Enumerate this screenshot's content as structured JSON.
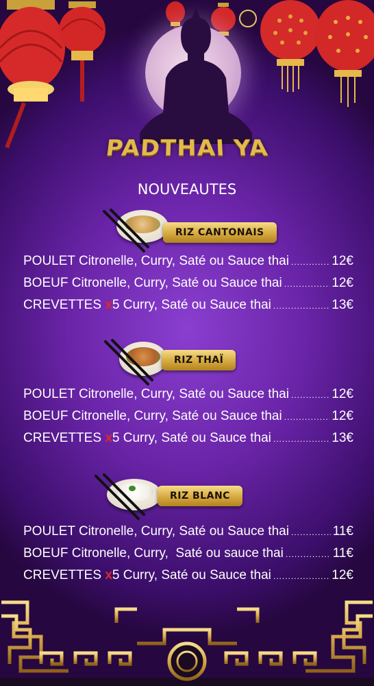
{
  "brand": "PADTHAI YA",
  "subtitle": "NOUVEAUTES",
  "sections": [
    {
      "title": "RIZ CANTONAIS",
      "items": [
        {
          "dish": "POULET Citronelle, Curry, Saté ou Sauce thai",
          "price": "12€"
        },
        {
          "dish": "BOEUF Citronelle, Curry, Saté ou Sauce thai",
          "price": "12€"
        },
        {
          "dish_prefix": "CREVETTES ",
          "multiplier_x": "x",
          "dish_suffix": "5 Curry, Saté ou Sauce thai",
          "price": "13€"
        }
      ]
    },
    {
      "title": "RIZ THAÏ",
      "items": [
        {
          "dish": "POULET Citronelle, Curry, Saté ou Sauce thai",
          "price": "12€"
        },
        {
          "dish": "BOEUF Citronelle, Curry, Saté ou Sauce thai",
          "price": "12€"
        },
        {
          "dish_prefix": "CREVETTES ",
          "multiplier_x": "x",
          "dish_suffix": "5 Curry, Saté ou Sauce thai",
          "price": "13€"
        }
      ]
    },
    {
      "title": "RIZ BLANC",
      "items": [
        {
          "dish": "POULET Citronelle, Curry, Saté ou Sauce thai",
          "price": "11€"
        },
        {
          "dish": "BOEUF Citronelle, Curry,  Saté ou sauce thai",
          "price": "11€"
        },
        {
          "dish_prefix": "CREVETTES ",
          "multiplier_x": "x",
          "dish_suffix": "5 Curry, Saté ou Sauce thai",
          "price": "12€"
        }
      ]
    }
  ],
  "colors": {
    "background": "#6a24a8",
    "gold": "#e3b94a",
    "accent_red": "#e3262b"
  },
  "decorations": [
    "red-lantern",
    "buddha-silhouette",
    "full-moon",
    "rice-bowl-chopsticks",
    "gold-fret-border"
  ]
}
